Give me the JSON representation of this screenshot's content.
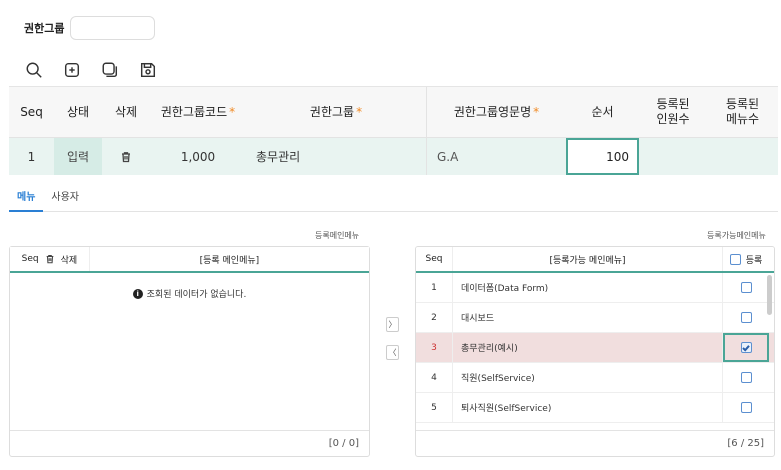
{
  "search": {
    "label": "권한그룹",
    "value": ""
  },
  "toolbar": {
    "icons": [
      "search-icon",
      "add-icon",
      "copy-icon",
      "save-icon"
    ]
  },
  "main_grid": {
    "columns": {
      "seq": "Seq",
      "status": "상태",
      "delete": "삭제",
      "code": "권한그룹코드",
      "name": "권한그룹",
      "ename": "권한그룹영문명",
      "order": "순서",
      "members": "등록된\n인원수",
      "menus": "등록된\n메뉴수"
    },
    "required_mark": "*",
    "rows": [
      {
        "seq": "1",
        "status": "입력",
        "code": "1,000",
        "name": "총무관리",
        "ename": "G.A",
        "order": "100",
        "members": "",
        "menus": ""
      }
    ]
  },
  "tabs": [
    {
      "label": "메뉴",
      "active": true
    },
    {
      "label": "사용자",
      "active": false
    }
  ],
  "left_panel": {
    "caption": "등록메인메뉴",
    "columns": {
      "seq": "Seq",
      "delete": "삭제",
      "name": "[등록 메인메뉴]"
    },
    "empty_message": "조회된 데이터가 없습니다.",
    "footer": "[0 / 0]"
  },
  "right_panel": {
    "caption": "등록가능메인메뉴",
    "columns": {
      "seq": "Seq",
      "name": "[등록가능 메인메뉴]",
      "register": "등록"
    },
    "rows": [
      {
        "seq": "1",
        "name": "데이터폼(Data Form)",
        "checked": false
      },
      {
        "seq": "2",
        "name": "대시보드",
        "checked": false
      },
      {
        "seq": "3",
        "name": "총무관리(예시)",
        "checked": true
      },
      {
        "seq": "4",
        "name": "직원(SelfService)",
        "checked": false
      },
      {
        "seq": "5",
        "name": "퇴사직원(SelfService)",
        "checked": false
      }
    ],
    "footer": "[6 / 25]"
  },
  "transfer": {
    "right_label": "〉",
    "left_label": "〈"
  },
  "colors": {
    "accent": "#4aa596",
    "tab_active": "#2a7fd4",
    "required": "#f08a24",
    "selected_row": "#f1dede",
    "input_row": "#e9f4f1"
  }
}
